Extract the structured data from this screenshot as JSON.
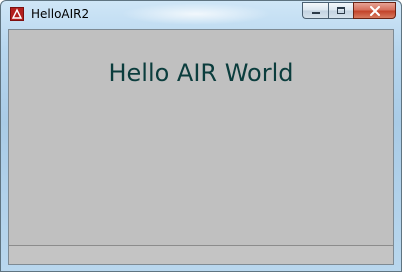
{
  "window": {
    "title": "HelloAIR2",
    "icon": "adobe-air-app-icon",
    "buttons": {
      "minimize_icon": "minimize-icon",
      "maximize_icon": "maximize-icon",
      "close_icon": "close-icon"
    }
  },
  "content": {
    "heading": "Hello AIR World",
    "text_color": "#0b3d3d",
    "background_color": "#c0c0c0"
  },
  "statusbar": {
    "text": ""
  }
}
